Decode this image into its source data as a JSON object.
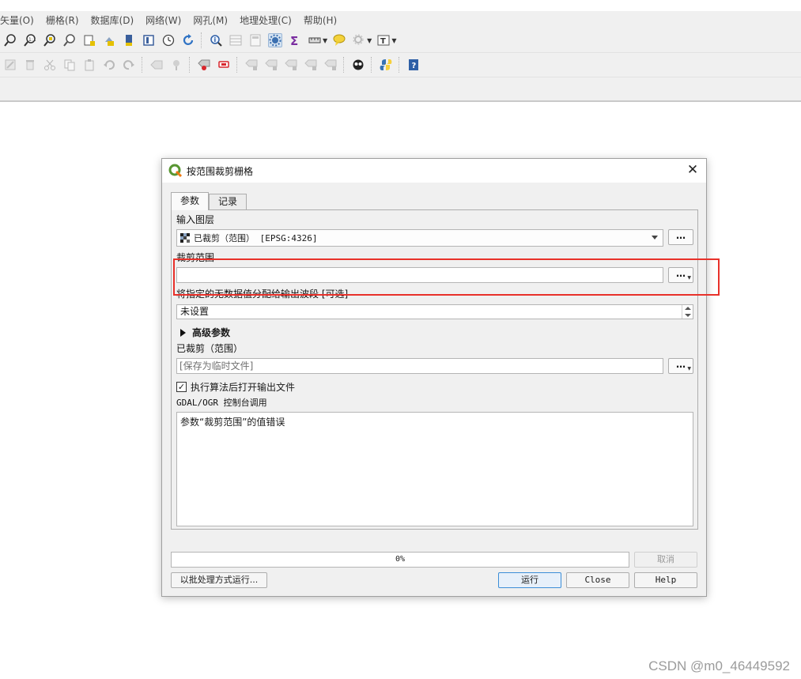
{
  "menubar": {
    "items": [
      "矢量(O)",
      "栅格(R)",
      "数据库(D)",
      "网络(W)",
      "网孔(M)",
      "地理处理(C)",
      "帮助(H)"
    ]
  },
  "toolbar1": {
    "icons": [
      "zoom-in-icon",
      "zoom-to-native-icon",
      "zoom-to-selection-icon",
      "zoom-to-layer-icon",
      "new-bookmark-icon",
      "show-bookmarks-icon",
      "pan-to-selection-icon",
      "new-map-view-icon",
      "temporal-controller-icon",
      "refresh-icon",
      "identify-icon",
      "attribute-table-icon",
      "field-calculator-icon",
      "processing-toolbox-icon",
      "statistics-icon",
      "measure-icon",
      "map-tips-icon",
      "settings-icon",
      "text-annotation-icon"
    ]
  },
  "toolbar2": {
    "icons": [
      "edit-icon",
      "delete-icon",
      "cut-icon",
      "copy-icon",
      "paste-icon",
      "undo-icon",
      "redo-icon",
      "label-icon",
      "label-pin-icon",
      "label-highlight-icon",
      "label-remove-icon",
      "label-move-icon",
      "label-rotate-icon",
      "label-change-icon",
      "label-toggle-icon",
      "label-history-icon",
      "plugin-icon",
      "python-icon",
      "help-icon"
    ]
  },
  "dialog": {
    "title": "按范围裁剪栅格",
    "tabs": [
      "参数",
      "记录"
    ],
    "input_layer_label": "输入图层",
    "input_layer_value": "已裁剪（范围） [EPSG:4326]",
    "extent_label": "裁剪范围",
    "extent_value": "",
    "nodata_label": "将指定的无数据值分配给输出波段 [可选]",
    "nodata_value": "未设置",
    "advanced_label": "高级参数",
    "output_label": "已裁剪（范围）",
    "output_placeholder": "[保存为临时文件]",
    "open_output_label": "执行算法后打开输出文件",
    "open_output_checked": "✓",
    "console_label": "GDAL/OGR 控制台调用",
    "console_text": "参数“裁剪范围”的值错误",
    "progress_text": "0%",
    "progress_value": 0,
    "ellipsis": "…",
    "buttons": {
      "cancel": "取消",
      "batch": "以批处理方式运行...",
      "run": "运行",
      "close": "Close",
      "help": "Help"
    }
  },
  "watermark": "CSDN @m0_46449592",
  "colors": {
    "highlight": "#e8312a",
    "default_button": "#3c8ed7"
  }
}
